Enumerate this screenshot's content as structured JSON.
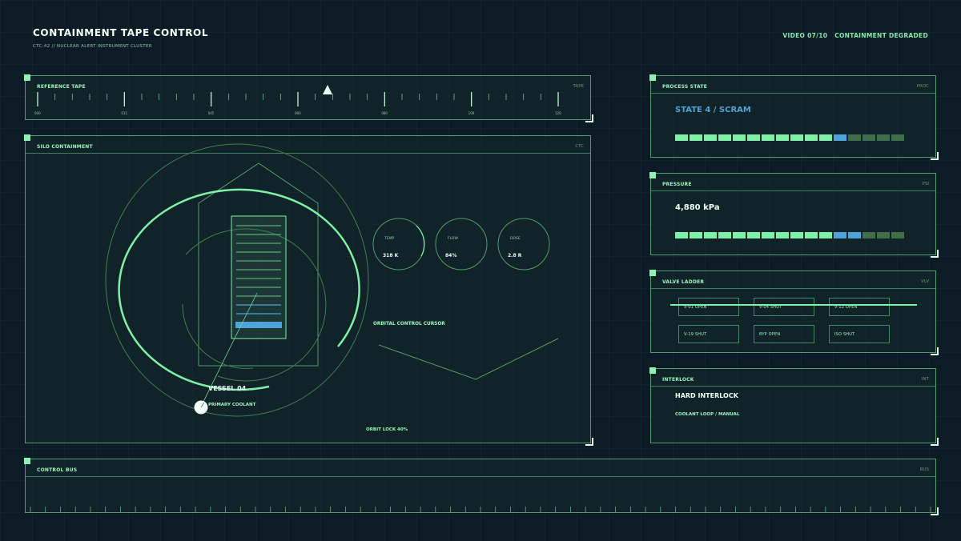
{
  "header": {
    "title": "CONTAINMENT TAPE CONTROL",
    "subtitle": "CTC-42 // NUCLEAR ALERT INSTRUMENT CLUSTER",
    "video": "VIDEO 07/10",
    "condition": "CONTAINMENT DEGRADED"
  },
  "tape": {
    "title": "REFERENCE TAPE",
    "tag": "TAPE",
    "labels": [
      "000",
      "015",
      "045",
      "060",
      "080",
      "100",
      "120"
    ]
  },
  "silo": {
    "title": "SILO CONTAINMENT",
    "tag": "CTC",
    "vessel_label": "VESSEL 04",
    "coolant_label": "PRIMARY COOLANT",
    "cursor_label": "ORBITAL CONTROL CURSOR",
    "orbit_lock": "ORBIT LOCK 40%",
    "gauges": [
      {
        "label": "TEMP",
        "value": "318 K"
      },
      {
        "label": "FLOW",
        "value": "84%"
      },
      {
        "label": "DOSE",
        "value": "2.8 R"
      }
    ]
  },
  "process": {
    "title": "PROCESS STATE",
    "tag": "PROC",
    "state": "STATE 4 / SCRAM",
    "segments": [
      "on",
      "on",
      "on",
      "on",
      "on",
      "on",
      "on",
      "on",
      "on",
      "on",
      "on",
      "blue",
      "dim",
      "dim",
      "dim",
      "dim"
    ]
  },
  "pressure": {
    "title": "PRESSURE",
    "tag": "PSI",
    "value": "4,880 kPa",
    "segments": [
      "on",
      "on",
      "on",
      "on",
      "on",
      "on",
      "on",
      "on",
      "on",
      "on",
      "on",
      "blue",
      "blue",
      "dim",
      "dim",
      "dim"
    ]
  },
  "valves": {
    "title": "VALVE LADDER",
    "tag": "VLV",
    "items": [
      {
        "label": "V-01  OPEN"
      },
      {
        "label": "V-04  SHUT"
      },
      {
        "label": "V-12  OPEN"
      },
      {
        "label": "V-19  SHUT"
      },
      {
        "label": "BYP  OPEN"
      },
      {
        "label": "ISO  SHUT"
      }
    ]
  },
  "interlock": {
    "title": "INTERLOCK",
    "tag": "INT",
    "state": "HARD INTERLOCK",
    "detail": "COOLANT LOOP / MANUAL"
  },
  "bus": {
    "title": "CONTROL BUS",
    "tag": "BUS"
  },
  "colors": {
    "on": "#7ff0a8",
    "blue": "#4ea3d8",
    "dim": "#3f6e48"
  }
}
